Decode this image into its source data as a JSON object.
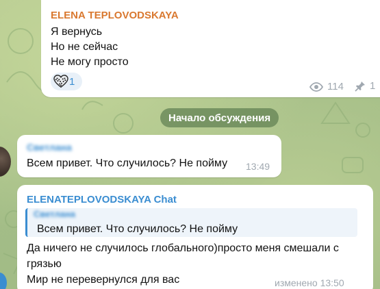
{
  "post": {
    "author": "ELENA TEPLOVODSKAYA",
    "lines": [
      "Я вернусь",
      "Но не сейчас",
      "Не могу просто"
    ],
    "reaction": {
      "icon": "heart-icon",
      "count": "1"
    },
    "views": "114",
    "pins": "1"
  },
  "service_message": "Начало обсуждения",
  "messages": [
    {
      "sender": "Светлана",
      "text": "Всем привет. Что случилось? Не пойму",
      "time": "13:49"
    },
    {
      "sender": "ELENATEPLOVODSKAYA Chat",
      "reply": {
        "name": "Светлана",
        "text": "Всем привет. Что случилось? Не пойму"
      },
      "lines": [
        "Да ничего не случилось глобального)просто меня смешали с",
        "грязью",
        "Мир не перевернулся для вас"
      ],
      "time": "изменено 13:50"
    }
  ],
  "colors": {
    "author_orange": "#d9782f",
    "link_blue": "#3a8dd1",
    "wallpaper": "#a9c28e",
    "meta_gray": "#a0a8b0"
  }
}
